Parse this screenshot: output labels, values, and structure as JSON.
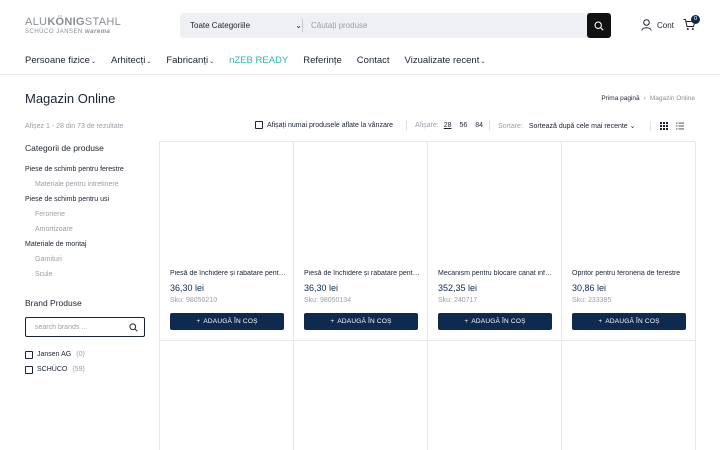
{
  "header": {
    "logo": {
      "part1": "ALU",
      "part2": "KÖNIG",
      "part3": "STAHL",
      "sub1": "SCHÜCO",
      "sub2": "JANSEN",
      "sub3": "warema"
    },
    "search": {
      "category": "Toate Categoriile",
      "placeholder": "Căutați produse"
    },
    "account_label": "Cont",
    "cart_count": "0"
  },
  "nav": {
    "items": [
      {
        "label": "Persoane fizice"
      },
      {
        "label": "Arhitecți"
      },
      {
        "label": "Fabricanți"
      },
      {
        "label": "nZEB READY"
      },
      {
        "label": "Referințe"
      },
      {
        "label": "Contact"
      },
      {
        "label": "Vizualizate recent"
      }
    ]
  },
  "page": {
    "title": "Magazin Online",
    "breadcrumb": {
      "home": "Prima pagină",
      "current": "Magazin Online"
    },
    "result_count": "Afișez 1 - 28 din 73 de rezultate"
  },
  "toolbar": {
    "in_stock_label": "Afișați numai produsele aflate la vânzare",
    "show_label": "Afișare:",
    "show_options": [
      "28",
      "56",
      "84"
    ],
    "sort_label": "Sortare:",
    "sort_value": "Sortează după cele mai recente"
  },
  "sidebar": {
    "categories_title": "Categorii de produse",
    "categories": [
      {
        "label": "Piese de schimb pentru ferestre"
      },
      {
        "label": "Materiale pentru intretinere"
      },
      {
        "label": "Piese de schimb pentru usi"
      },
      {
        "label": "Feronerie"
      },
      {
        "label": "Amortizoare"
      },
      {
        "label": "Materiale de montaj"
      },
      {
        "label": "Garnituri"
      },
      {
        "label": "Scule"
      }
    ],
    "brand_title": "Brand Produse",
    "brand_search_placeholder": "search brands ...",
    "brands": [
      {
        "name": "Jansen AG",
        "count": "(0)"
      },
      {
        "name": "SCHÜCO",
        "count": "(59)"
      }
    ]
  },
  "products": [
    {
      "title": "Piesă de închidere și rabatare pentru ferestre",
      "price": "36,30 lei",
      "sku": "Sku: 98050210",
      "button": "ADAUGĂ ÎN COȘ"
    },
    {
      "title": "Piesă de închidere și rabatare pentru ferestre",
      "price": "36,30 lei",
      "sku": "Sku: 98050134",
      "button": "ADAUGĂ ÎN COȘ"
    },
    {
      "title": "Mecanism pentru blocare canat inferior",
      "price": "352,35 lei",
      "sku": "Sku: 240717",
      "button": "ADAUGĂ ÎN COȘ"
    },
    {
      "title": "Opritor pentru feroneria de ferestre",
      "price": "30,86 lei",
      "sku": "Sku: 233385",
      "button": "ADAUGĂ ÎN COȘ"
    }
  ],
  "colors": {
    "primary": "#0f2a4f",
    "accent": "#2bb5b0",
    "muted": "#9aa0a8"
  }
}
